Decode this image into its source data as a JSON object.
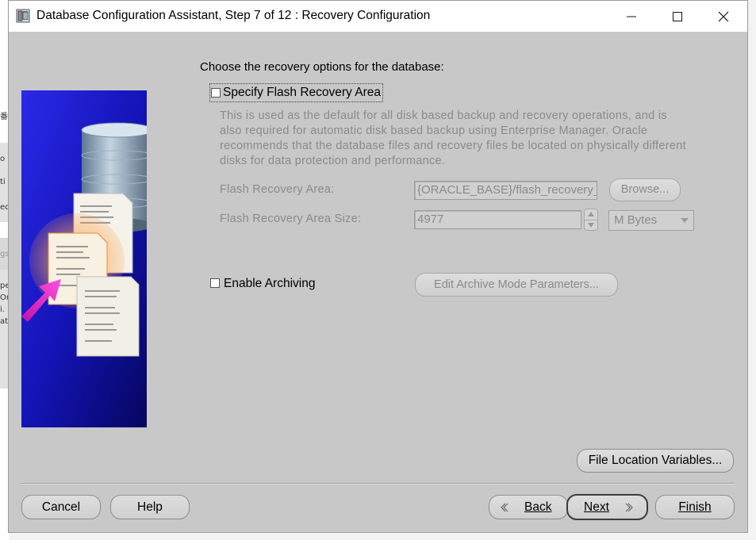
{
  "window": {
    "title": "Database Configuration Assistant, Step 7 of 12 : Recovery Configuration"
  },
  "main": {
    "prompt": "Choose the recovery options for the database:",
    "flash_recovery": {
      "checkbox_label": "Specify Flash Recovery Area",
      "checked": false,
      "description_lines": [
        "This is used as the default for all disk based backup and recovery operations, and is",
        "also required for automatic disk based backup using Enterprise Manager. Oracle",
        "recommends that the database files and recovery files be located on physically different",
        "disks for data protection and performance."
      ],
      "area_label": "Flash Recovery Area:",
      "area_value": "{ORACLE_BASE}/flash_recovery_",
      "browse_label": "Browse...",
      "size_label": "Flash Recovery Area Size:",
      "size_value": "4977",
      "unit_selected": "M Bytes"
    },
    "archiving": {
      "checkbox_label": "Enable Archiving",
      "checked": false,
      "params_button": "Edit Archive Mode Parameters..."
    },
    "file_location_button": "File Location Variables..."
  },
  "footer": {
    "cancel": "Cancel",
    "help": "Help",
    "back": "Back",
    "next": "Next",
    "finish": "Finish"
  },
  "colors": {
    "dialog_bg": "#c8c8c8",
    "disabled_text": "#8a8a8a",
    "side_panel_blue": "#1a1acc",
    "arrow_magenta": "#e020c0"
  },
  "background_window": {
    "fragments": [
      "番",
      "o",
      "ti",
      "ed",
      "gs",
      "pe",
      "Or",
      "i.",
      "at"
    ]
  }
}
